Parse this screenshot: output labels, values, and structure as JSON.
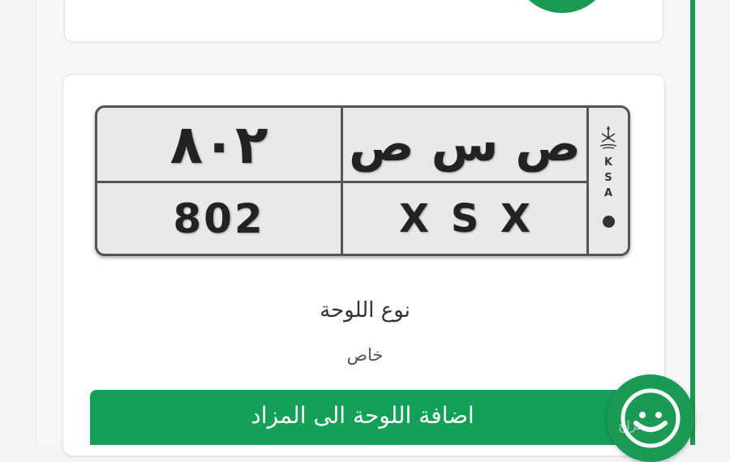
{
  "plate": {
    "numbers_ar": "٨٠٢",
    "letters_ar": "ص س ص",
    "numbers_en": "802",
    "letters_en": "X S X",
    "country_code": [
      "K",
      "S",
      "A"
    ]
  },
  "details": {
    "plate_type_label": "نوع اللوحة",
    "plate_type_value": "خاص"
  },
  "actions": {
    "add_to_auction_label": "اضافة اللوحة الى المزاد"
  },
  "watermark_text": "حراج",
  "colors": {
    "brand_green": "#1a9a54",
    "button_green": "#14a058",
    "plate_bg": "#e9e9e9"
  },
  "icons": {
    "fab": "chat-bubble-icon",
    "emblem": "saudi-emblem-icon"
  }
}
